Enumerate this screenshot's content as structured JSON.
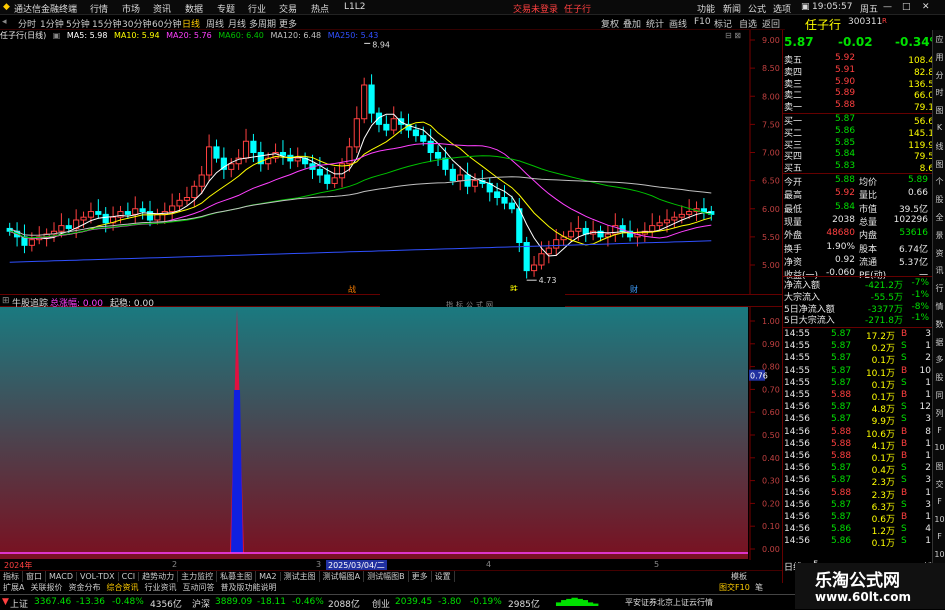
{
  "titlebar": {
    "app": "通达信金融终端",
    "menus": [
      "行情",
      "市场",
      "资讯",
      "数据",
      "专题",
      "行业",
      "交易",
      "热点",
      "L1L2"
    ],
    "login": "交易未登录",
    "stock": "任子行",
    "right_menus": [
      "功能",
      "新闻",
      "公式",
      "选项"
    ],
    "time": "19:05:57",
    "weekday": "周五"
  },
  "toolbar": {
    "periods": [
      "分时",
      "1分钟",
      "5分钟",
      "15分钟",
      "30分钟",
      "60分钟",
      "日线",
      "周线",
      "月线",
      "多周期",
      "更多"
    ],
    "active": "日线",
    "right": [
      "复权",
      "叠加",
      "统计",
      "画线",
      "F10",
      "标记",
      "自选",
      "返回"
    ]
  },
  "stock": {
    "name": "任子行",
    "code": "300311",
    "flag": "R"
  },
  "ma": {
    "title": "任子行(日线)",
    "ma5": "MA5: 5.98",
    "ma10": "MA10: 5.94",
    "ma20": "MA20: 5.76",
    "ma60": "MA60: 6.40",
    "ma120": "MA120: 6.48",
    "ma250": "MA250: 5.43",
    "high_label": "8.94",
    "low_label": "4.73"
  },
  "yaxis_k": [
    "9.00",
    "8.50",
    "8.00",
    "7.50",
    "7.00",
    "6.50",
    "6.00",
    "5.50",
    "5.00"
  ],
  "yaxis_i": [
    "1.00",
    "0.90",
    "0.80",
    "0.70",
    "0.60",
    "0.50",
    "0.40",
    "0.30",
    "0.20",
    "0.10",
    "0.00"
  ],
  "cur_i": "0.76",
  "markers": [
    "战",
    "跌",
    "财"
  ],
  "watermark": "指标公式网",
  "indicator": {
    "name": "牛股追踪",
    "a": "总涨幅: 0.00",
    "b": "起稳: 0.00"
  },
  "xaxis": [
    "2024年",
    "2",
    "3",
    "2025/03/04/二",
    "4",
    "5"
  ],
  "quote": {
    "price": "5.87",
    "chg": "-0.02",
    "pct": "-0.34%",
    "asks": [
      {
        "l": "卖五",
        "p": "5.92",
        "v": "108.4万"
      },
      {
        "l": "卖四",
        "p": "5.91",
        "v": "82.8万"
      },
      {
        "l": "卖三",
        "p": "5.90",
        "v": "136.5万"
      },
      {
        "l": "卖二",
        "p": "5.89",
        "v": "66.0万"
      },
      {
        "l": "卖一",
        "p": "5.88",
        "v": "79.1万"
      }
    ],
    "bids": [
      {
        "l": "买一",
        "p": "5.87",
        "v": "56.6万"
      },
      {
        "l": "买二",
        "p": "5.86",
        "v": "145.1万"
      },
      {
        "l": "买三",
        "p": "5.85",
        "v": "119.9万"
      },
      {
        "l": "买四",
        "p": "5.84",
        "v": "79.5万"
      },
      {
        "l": "买五",
        "p": "5.83",
        "v": "8.6万"
      }
    ],
    "stats": [
      [
        "今开",
        "5.88",
        "均价",
        "5.89"
      ],
      [
        "最高",
        "5.92",
        "量比",
        "0.66"
      ],
      [
        "最低",
        "5.84",
        "市值",
        "39.5亿"
      ],
      [
        "现量",
        "2038",
        "总量",
        "102296"
      ],
      [
        "外盘",
        "48680",
        "内盘",
        "53616"
      ],
      [
        "换手",
        "1.90%",
        "股本",
        "6.74亿"
      ],
      [
        "净资",
        "0.92",
        "流通",
        "5.37亿"
      ],
      [
        "收益(一)",
        "-0.060",
        "PE(动)",
        "一"
      ]
    ],
    "flows": [
      [
        "净流入额",
        "-421.2万",
        "-7%"
      ],
      [
        "大宗流入",
        "-55.5万",
        "-1%"
      ],
      [
        "5日净流入额",
        "-3377万",
        "-8%"
      ],
      [
        "5日大宗流入",
        "-271.8万",
        "-1%"
      ]
    ],
    "ticks": [
      [
        "14:55",
        "5.87",
        "17.2万",
        "B",
        "3"
      ],
      [
        "14:55",
        "5.87",
        "0.2万",
        "S",
        "1"
      ],
      [
        "14:55",
        "5.87",
        "0.1万",
        "S",
        "2"
      ],
      [
        "14:55",
        "5.87",
        "10.1万",
        "B",
        "10"
      ],
      [
        "14:55",
        "5.87",
        "0.1万",
        "S",
        "1"
      ],
      [
        "14:55",
        "5.88",
        "0.1万",
        "B",
        "1"
      ],
      [
        "14:56",
        "5.87",
        "4.8万",
        "S",
        "12"
      ],
      [
        "14:56",
        "5.87",
        "9.9万",
        "S",
        "3"
      ],
      [
        "14:56",
        "5.88",
        "10.6万",
        "B",
        "8"
      ],
      [
        "14:56",
        "5.88",
        "4.1万",
        "B",
        "1"
      ],
      [
        "14:56",
        "5.88",
        "0.1万",
        "B",
        "1"
      ],
      [
        "14:56",
        "5.87",
        "0.4万",
        "S",
        "2"
      ],
      [
        "14:56",
        "5.87",
        "2.3万",
        "S",
        "3"
      ],
      [
        "14:56",
        "5.88",
        "2.3万",
        "B",
        "1"
      ],
      [
        "14:56",
        "5.87",
        "6.3万",
        "S",
        "3"
      ],
      [
        "14:56",
        "5.87",
        "0.6万",
        "B",
        "1"
      ],
      [
        "14:56",
        "5.86",
        "1.2万",
        "S",
        "4"
      ],
      [
        "14:56",
        "5.86",
        "0.1万",
        "S",
        "1"
      ]
    ]
  },
  "tabs": [
    "指标",
    "窗口",
    "MACD",
    "VOL-TDX",
    "CCI",
    "趋势动力",
    "主力监控",
    "私募主图",
    "MA2",
    "测试主图",
    "测试幅图A",
    "测试幅图B",
    "更多",
    "设置"
  ],
  "tabs2": [
    "扩展A",
    "关联报价",
    "资金分布",
    "综合资讯",
    "行业资讯",
    "互动问答",
    "普及版功能说明"
  ],
  "tabs_right": [
    "模板"
  ],
  "right_tabs": [
    "日线",
    "5",
    "图交F10",
    "笔",
    "新"
  ],
  "sidebar": [
    "应",
    "用",
    "分",
    "时",
    "图",
    "K",
    "线",
    "图",
    "个",
    "股",
    "全",
    "景",
    "资",
    "讯",
    "行",
    "情",
    "数",
    "据",
    "多",
    "股",
    "同",
    "列",
    "F",
    "10",
    "图",
    "交",
    "F",
    "10",
    "F",
    "10"
  ],
  "status": {
    "sh": "上证",
    "sh_v": "3367.46",
    "sh_c": "-13.36",
    "sh_p": "-0.48%",
    "sh_a": "4356亿",
    "sz": "沪深",
    "sz_v": "3889.09",
    "sz_c": "-18.11",
    "sz_p": "-0.46%",
    "sz_a": "2088亿",
    "cy": "创业",
    "cy_v": "2039.45",
    "cy_c": "-3.80",
    "cy_p": "-0.19%",
    "cy_a": "2985亿",
    "broker": "平安证券北京上证云行情"
  },
  "logo": {
    "title": "乐淘公式网",
    "url": "www.60lt.com"
  },
  "colors": {
    "up": "#ff4040",
    "down": "#00ffff",
    "ma5": "#ffffff",
    "ma10": "#ffff00",
    "ma20": "#ff40ff",
    "ma60": "#00c000",
    "ma120": "#c0c0c0",
    "ma250": "#3050ff"
  }
}
